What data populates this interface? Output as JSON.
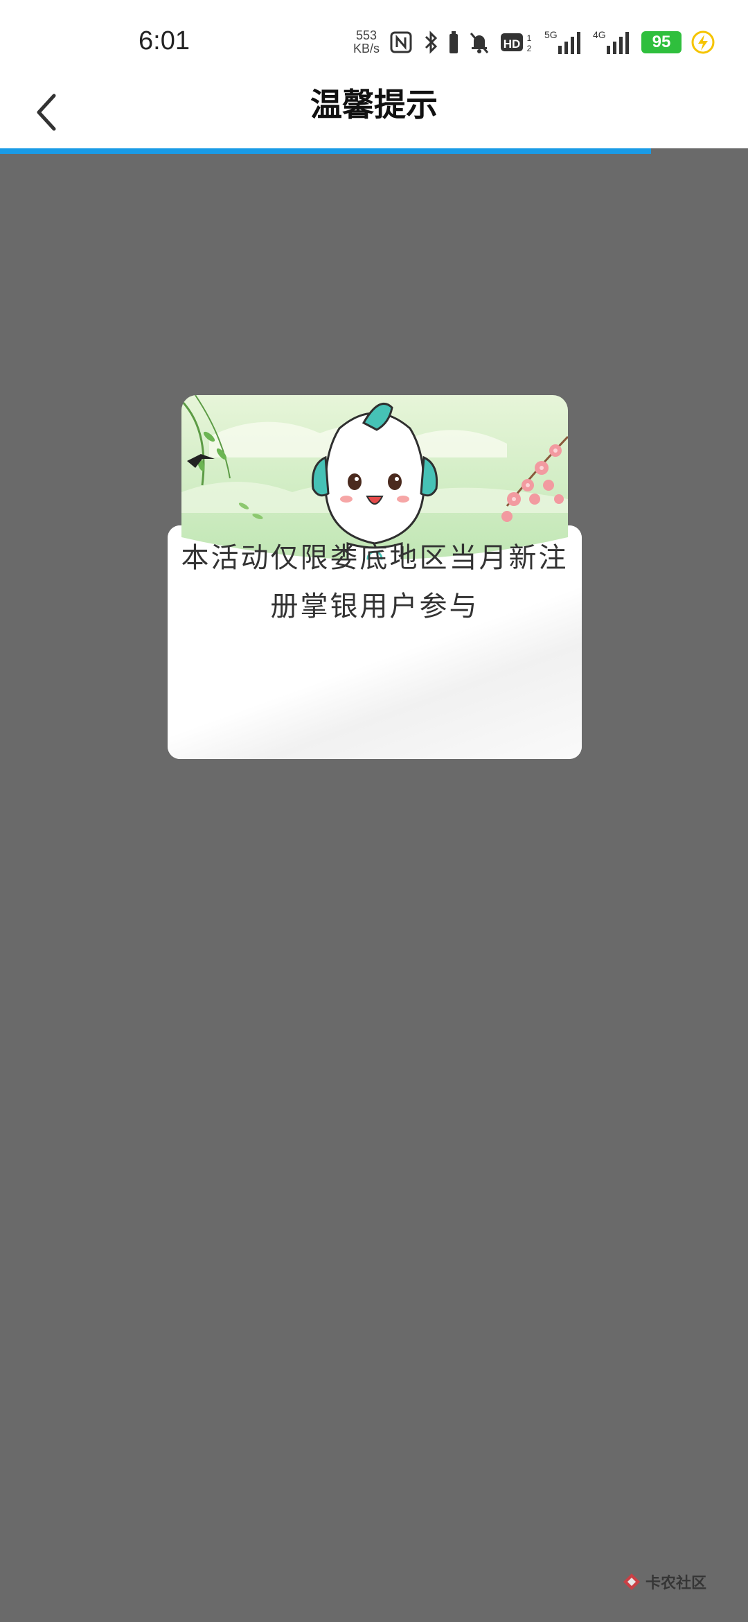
{
  "status_bar": {
    "time": "6:01",
    "net_speed_value": "553",
    "net_speed_unit": "KB/s",
    "hd_label": "HD",
    "sim1_label": "5G",
    "sim2_label": "4G",
    "battery_level": "95",
    "icons": [
      "nfc-icon",
      "bluetooth-icon",
      "battery-saver-icon",
      "mute-bell-icon",
      "hd-call-icon",
      "signal-5g-icon",
      "signal-4g-icon",
      "battery-icon",
      "charging-icon"
    ]
  },
  "header": {
    "title": "温馨提示",
    "back_icon": "chevron-left-icon",
    "progress": 0.87,
    "progress_color": "#1a9be6"
  },
  "dialog": {
    "message_line1": "本活动仅限娄底地区当月新注",
    "message_line2": "册掌银用户参与",
    "illustration": "mascot-spring-scene"
  },
  "watermark": {
    "text": "卡农社区"
  },
  "colors": {
    "overlay": "#6a6a6a",
    "header_bg": "#ffffff",
    "accent": "#1a9be6",
    "battery": "#2fbf3d",
    "charging": "#f5c400"
  }
}
